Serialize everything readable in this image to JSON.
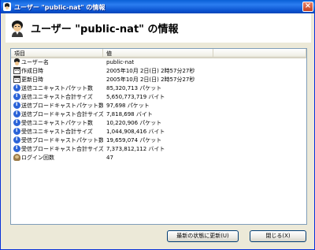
{
  "window": {
    "title": "ユーザー \"public-nat\" の情報",
    "close_label": "×"
  },
  "header": {
    "title": "ユーザー \"public-nat\" の情報"
  },
  "listview": {
    "columns": [
      "項目",
      "値"
    ],
    "rows": [
      {
        "icon": "user-icon",
        "name": "ユーザー名",
        "value": "public-nat"
      },
      {
        "icon": "calendar-icon",
        "name": "作成日時",
        "value": "2005年10月 2日(日)  2時57分27秒"
      },
      {
        "icon": "calendar-icon",
        "name": "更新日時",
        "value": "2005年10月 2日(日)  2時57分27秒"
      },
      {
        "icon": "info-icon",
        "name": "送信ユニキャストパケット数",
        "value": "85,320,713 パケット"
      },
      {
        "icon": "info-icon",
        "name": "送信ユニキャスト合計サイズ",
        "value": "5,650,773,719 バイト"
      },
      {
        "icon": "info-icon",
        "name": "送信ブロードキャストパケット数",
        "value": "97,698 パケット"
      },
      {
        "icon": "info-icon",
        "name": "送信ブロードキャスト合計サイズ",
        "value": "7,818,698 バイト"
      },
      {
        "icon": "info-icon",
        "name": "受信ユニキャストパケット数",
        "value": "10,220,906 パケット"
      },
      {
        "icon": "info-icon",
        "name": "受信ユニキャスト合計サイズ",
        "value": "1,044,908,416 バイト"
      },
      {
        "icon": "info-icon",
        "name": "受信ブロードキャストパケット数",
        "value": "19,659,074 パケット"
      },
      {
        "icon": "info-icon",
        "name": "受信ブロードキャスト合計サイズ",
        "value": "7,373,812,112 バイト"
      },
      {
        "icon": "login-icon",
        "name": "ログイン回数",
        "value": "47"
      }
    ]
  },
  "buttons": {
    "refresh": "最新の状態に更新(U)",
    "close": "閉じる(X)"
  },
  "colors": {
    "titlebar": "#0a5fd6",
    "dialog_bg": "#ece9d8",
    "info_icon": "#2a63d8"
  }
}
